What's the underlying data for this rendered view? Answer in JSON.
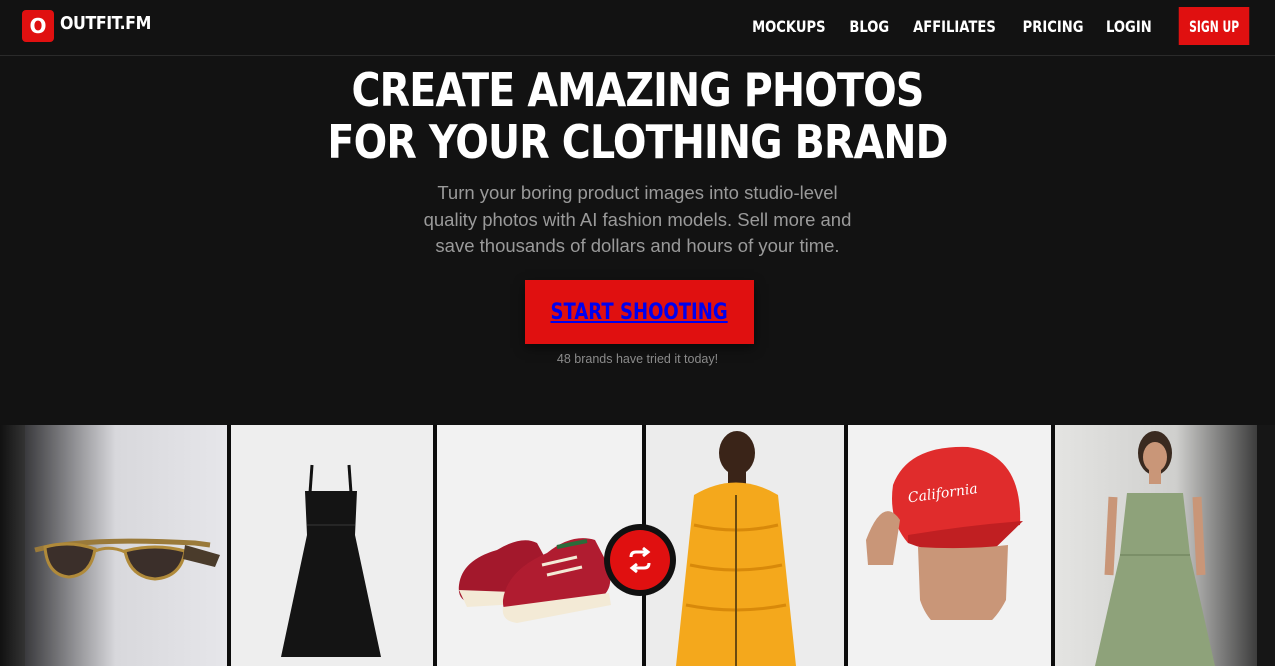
{
  "brand": {
    "logo_letter": "O",
    "name": "OUTFIT.FM"
  },
  "nav": {
    "items": [
      "MOCKUPS",
      "BLOG",
      "AFFILIATES",
      "PRICING",
      "LOGIN"
    ],
    "signup_label": "SIGN UP"
  },
  "hero": {
    "title_line1": "CREATE AMAZING PHOTOS",
    "title_line2": "FOR YOUR CLOTHING BRAND",
    "subtitle_line1": "Turn your boring product images into studio-level",
    "subtitle_line2": "quality photos with AI fashion models. Sell more and",
    "subtitle_line3": "save thousands of dollars and hours of your time.",
    "cta_label": "START SHOOTING",
    "cta_note": "48 brands have tried it today!"
  },
  "gallery": {
    "product_images": [
      "sunglasses-image",
      "black-dress-image",
      "red-sneakers-image"
    ],
    "model_images": [
      "yellow-puffer-jacket-model",
      "red-california-cap-model",
      "green-dress-model"
    ],
    "cap_text": "California",
    "swap_icon": "swap-arrows-icon"
  },
  "colors": {
    "accent": "#e01010",
    "background": "#121212",
    "muted_text": "#9a9a9a"
  }
}
